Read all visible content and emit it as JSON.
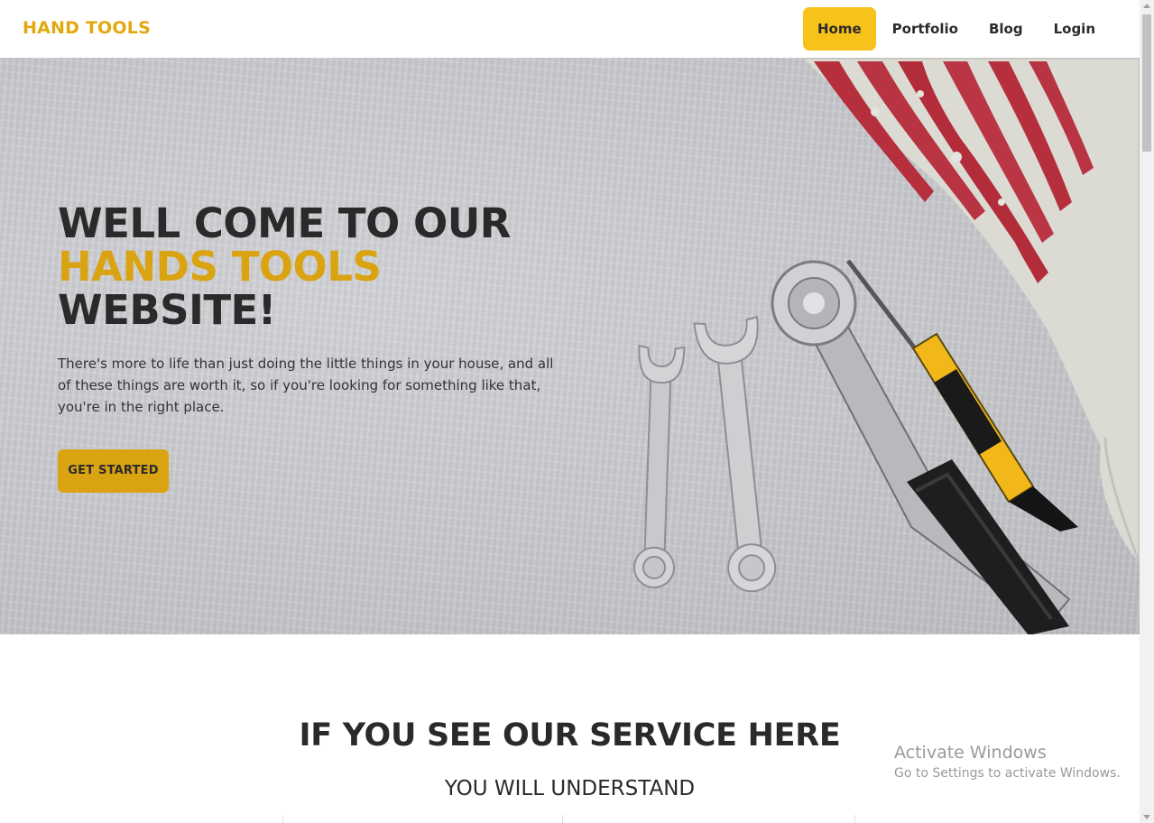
{
  "header": {
    "logo": "HAND TOOLS",
    "nav": [
      {
        "label": "Home",
        "active": true
      },
      {
        "label": "Portfolio",
        "active": false
      },
      {
        "label": "Blog",
        "active": false
      },
      {
        "label": "Login",
        "active": false
      }
    ]
  },
  "hero": {
    "title_line1": "WELL COME TO OUR",
    "title_highlight": "HANDS TOOLS",
    "title_line3": "WEBSITE!",
    "description": "There's more to life than just doing the little things in your house, and all of these things are worth it, so if you're looking for something like that, you're in the right place.",
    "cta_label": "GET STARTED",
    "image_subject": "wrenches-ratchet-screwdriver-on-wood"
  },
  "service": {
    "title": "IF YOU SEE OUR SERVICE HERE",
    "subtitle": "YOU WILL UNDERSTAND"
  },
  "watermark": {
    "title": "Activate Windows",
    "subtitle": "Go to Settings to activate Windows."
  },
  "colors": {
    "accent": "#f7c21a",
    "accent_dark": "#d9a312",
    "logo": "#e3a80e",
    "text": "#2a2a2a"
  },
  "icons": [
    "chevron-up-icon",
    "chevron-down-icon"
  ]
}
